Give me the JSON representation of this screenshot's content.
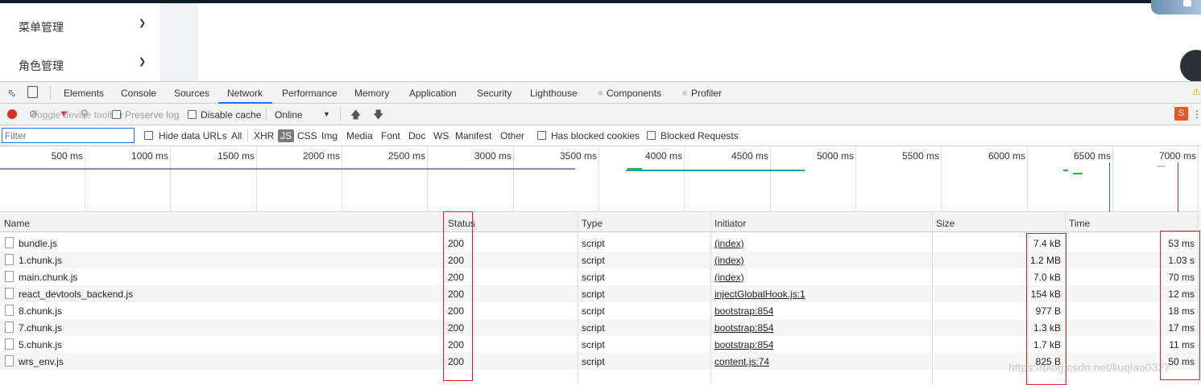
{
  "app_menu": {
    "items": [
      {
        "label": "菜单管理"
      },
      {
        "label": "角色管理"
      }
    ]
  },
  "devtools": {
    "tabs": [
      "Elements",
      "Console",
      "Sources",
      "Network",
      "Performance",
      "Memory",
      "Application",
      "Security",
      "Lighthouse",
      "Components",
      "Profiler"
    ],
    "active_tab": "Network",
    "toolbar": {
      "preserve_log_label": "Preserve log",
      "disable_cache_label": "Disable cache",
      "throttle_value": "Online",
      "tooltip_overlay": "Toggle device toolbar"
    },
    "filter": {
      "placeholder": "Filter",
      "hide_data_urls_label": "Hide data URLs",
      "types": [
        "All",
        "XHR",
        "JS",
        "CSS",
        "Img",
        "Media",
        "Font",
        "Doc",
        "WS",
        "Manifest",
        "Other"
      ],
      "active_type": "JS",
      "has_blocked_cookies_label": "Has blocked cookies",
      "blocked_requests_label": "Blocked Requests"
    },
    "overview": {
      "ticks": [
        "500 ms",
        "1000 ms",
        "1500 ms",
        "2000 ms",
        "2500 ms",
        "3000 ms",
        "3500 ms",
        "4000 ms",
        "4500 ms",
        "5000 ms",
        "5500 ms",
        "6000 ms",
        "6500 ms",
        "7000 ms"
      ]
    },
    "table": {
      "headers": {
        "name": "Name",
        "status": "Status",
        "type": "Type",
        "initiator": "Initiator",
        "size": "Size",
        "time": "Time"
      },
      "rows": [
        {
          "name": "bundle.js",
          "status": "200",
          "type": "script",
          "initiator": "(index)",
          "size": "7.4 kB",
          "time": "53 ms"
        },
        {
          "name": "1.chunk.js",
          "status": "200",
          "type": "script",
          "initiator": "(index)",
          "size": "1.2 MB",
          "time": "1.03 s"
        },
        {
          "name": "main.chunk.js",
          "status": "200",
          "type": "script",
          "initiator": "(index)",
          "size": "7.0 kB",
          "time": "70 ms"
        },
        {
          "name": "react_devtools_backend.js",
          "status": "200",
          "type": "script",
          "initiator": "injectGlobalHook.js:1",
          "size": "154 kB",
          "time": "12 ms"
        },
        {
          "name": "8.chunk.js",
          "status": "200",
          "type": "script",
          "initiator": "bootstrap:854",
          "size": "977 B",
          "time": "18 ms"
        },
        {
          "name": "7.chunk.js",
          "status": "200",
          "type": "script",
          "initiator": "bootstrap:854",
          "size": "1.3 kB",
          "time": "17 ms"
        },
        {
          "name": "5.chunk.js",
          "status": "200",
          "type": "script",
          "initiator": "bootstrap:854",
          "size": "1.7 kB",
          "time": "11 ms"
        },
        {
          "name": "wrs_env.js",
          "status": "200",
          "type": "script",
          "initiator": "content.js:74",
          "size": "825 B",
          "time": "50 ms"
        }
      ]
    }
  },
  "watermark": "https://blog.csdn.net/liuqiao0327",
  "colors": {
    "record": "#d93025",
    "active_tab_underline": "#1a73e8",
    "highlight_box": "#e02020"
  }
}
